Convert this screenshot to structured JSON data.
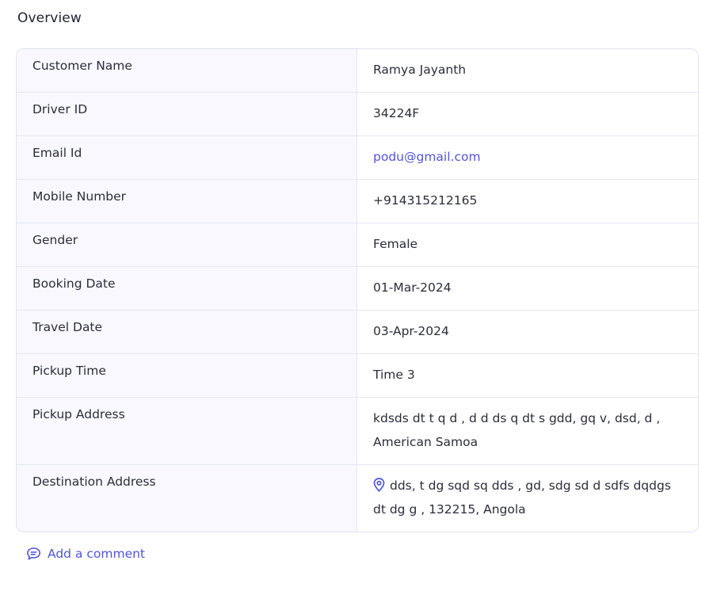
{
  "overview": {
    "title": "Overview"
  },
  "details": [
    {
      "label": "Customer Name",
      "value": "Ramya Jayanth"
    },
    {
      "label": "Driver ID",
      "value": "34224F"
    },
    {
      "label": "Email Id",
      "value": "podu@gmail.com"
    },
    {
      "label": "Mobile Number",
      "value": "+914315212165"
    },
    {
      "label": "Gender",
      "value": "Female"
    },
    {
      "label": "Booking Date",
      "value": "01-Mar-2024"
    },
    {
      "label": "Travel Date",
      "value": "03-Apr-2024"
    },
    {
      "label": "Pickup Time",
      "value": "Time 3"
    },
    {
      "label": "Pickup Address",
      "value_line1": "kdsds dt t q d , d d ds q dt s gdd, gq v, dsd, d ,",
      "value_line2": "American Samoa"
    },
    {
      "label": "Destination Address",
      "value_line1": "dds, t dg sqd sq dds , gd, sdg sd d sdfs dqdgs",
      "value_line2": "dt dg g , 132215, Angola",
      "icon": "location-pin-icon"
    }
  ],
  "actions": {
    "add_comment_label": "Add a comment",
    "add_comment_icon": "chat-bubble-icon"
  },
  "colors": {
    "accent": "#4f56d8",
    "label_background": "#f8f8fe",
    "border": "#e6e7f0"
  }
}
